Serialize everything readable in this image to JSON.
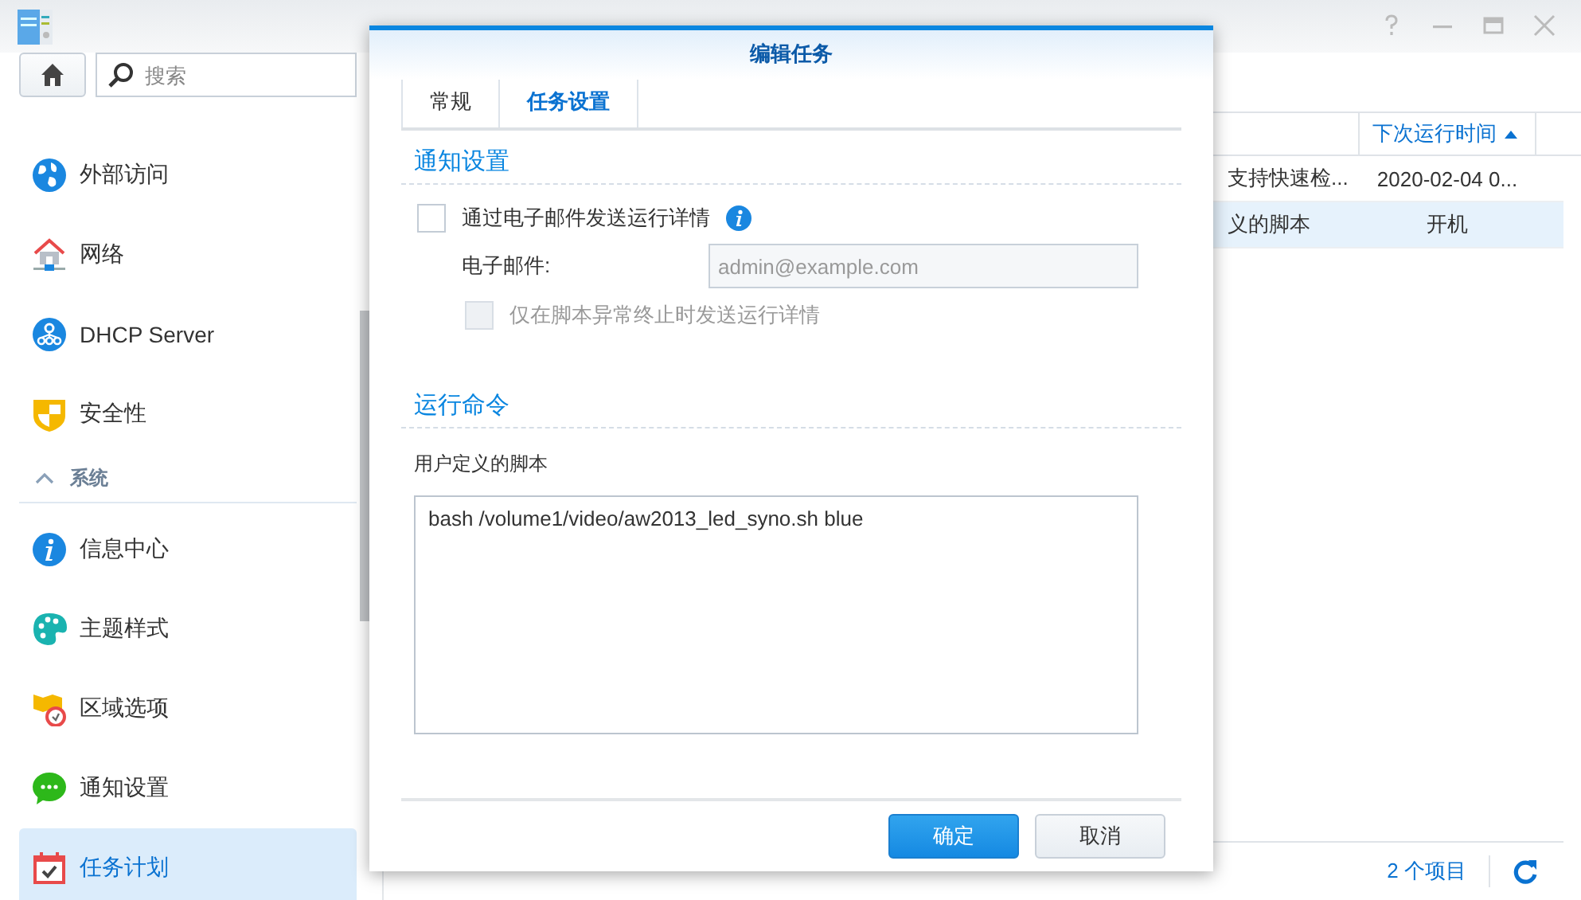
{
  "sidebar": {
    "search": {
      "placeholder": "搜索"
    },
    "items": [
      {
        "kind": "globe",
        "label": "外部访问",
        "selected": false
      },
      {
        "kind": "network",
        "label": "网络",
        "selected": false
      },
      {
        "kind": "dhcp",
        "label": "DHCP Server",
        "selected": false
      },
      {
        "kind": "shield",
        "label": "安全性",
        "selected": false
      },
      {
        "kind": "section",
        "label": "系统",
        "expanded": true
      },
      {
        "kind": "info",
        "label": "信息中心",
        "selected": false
      },
      {
        "kind": "palette",
        "label": "主题样式",
        "selected": false
      },
      {
        "kind": "region",
        "label": "区域选项",
        "selected": false
      },
      {
        "kind": "chat",
        "label": "通知设置",
        "selected": false
      },
      {
        "kind": "calendar",
        "label": "任务计划",
        "selected": true
      }
    ]
  },
  "table": {
    "columns": [
      {},
      {
        "label": "下次运行时间",
        "sorted": true
      }
    ],
    "rows": [
      {
        "cells": [
          "支持快速检...",
          "2020-02-04 0..."
        ],
        "selected": false
      },
      {
        "cells": [
          "义的脚本",
          "开机"
        ],
        "selected": true
      }
    ]
  },
  "status_bar": {
    "count": "2 个项目"
  },
  "dialog": {
    "title": "编辑任务",
    "tabs": [
      {
        "label": "常规",
        "selected": false
      },
      {
        "label": "任务设置",
        "selected": true
      }
    ],
    "notify": {
      "heading": "通知设置",
      "email_details": {
        "label": "通过电子邮件发送运行详情",
        "checked": false
      },
      "email": {
        "label": "电子邮件:",
        "value": "admin@example.com",
        "disabled": true
      },
      "abnormal_only": {
        "label": "仅在脚本异常终止时发送运行详情",
        "checked": false,
        "disabled": true
      }
    },
    "command": {
      "heading": "运行命令",
      "label": "用户定义的脚本",
      "script": "bash /volume1/video/aw2013_led_syno.sh blue"
    },
    "buttons": [
      {
        "kind": "primary",
        "label": "确定"
      },
      {
        "kind": "secondary",
        "label": "取消"
      }
    ]
  }
}
